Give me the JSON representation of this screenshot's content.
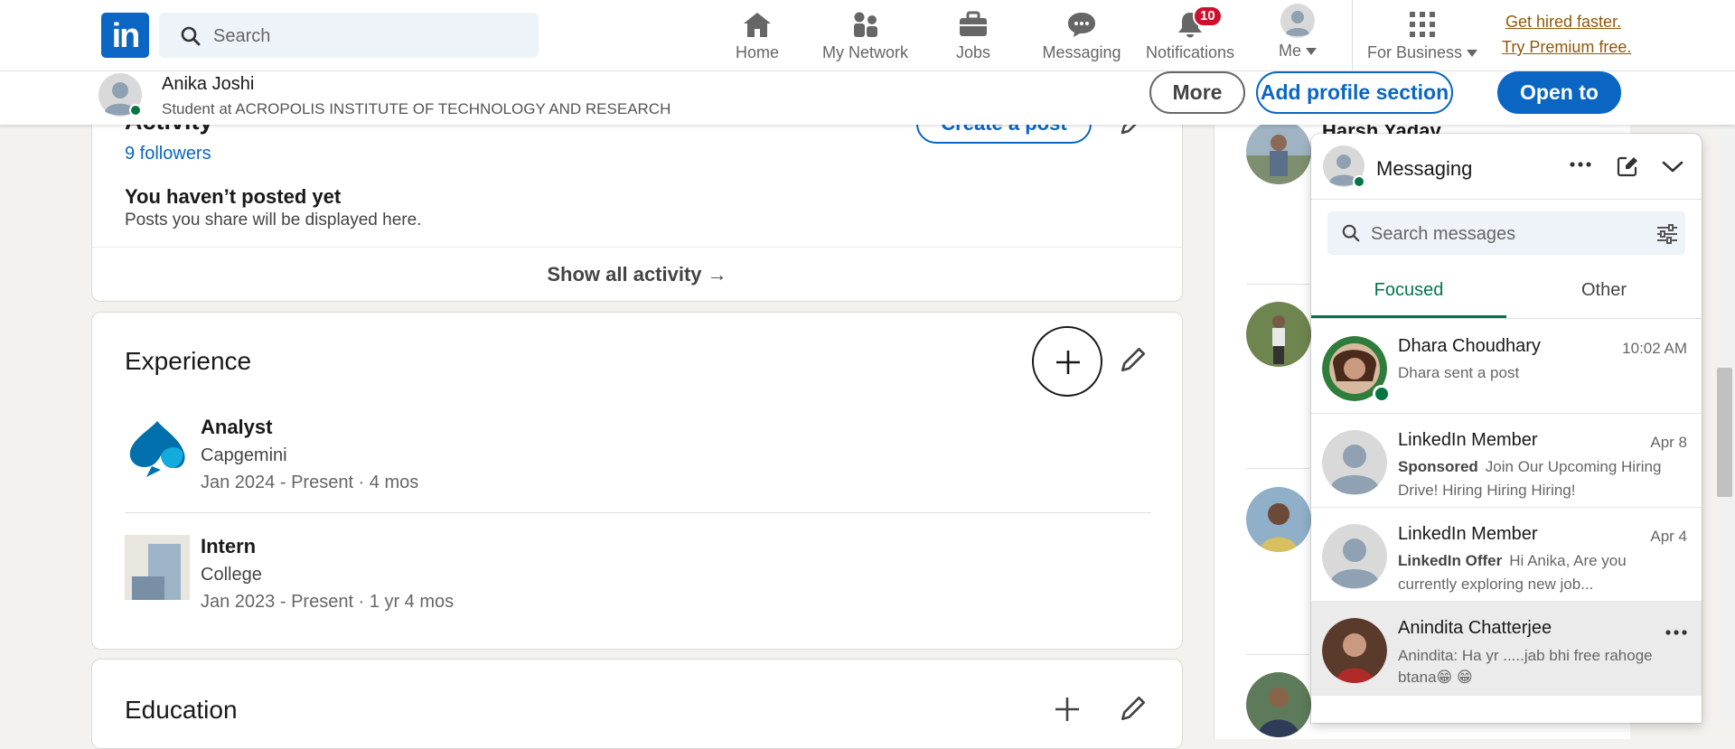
{
  "nav": {
    "logo_text": "in",
    "search_placeholder": "Search",
    "items": [
      {
        "label": "Home",
        "icon": "home-icon"
      },
      {
        "label": "My Network",
        "icon": "network-icon"
      },
      {
        "label": "Jobs",
        "icon": "briefcase-icon"
      },
      {
        "label": "Messaging",
        "icon": "messaging-icon"
      },
      {
        "label": "Notifications",
        "icon": "bell-icon",
        "badge": "10"
      },
      {
        "label": "Me",
        "icon": "avatar"
      }
    ],
    "business_label": "For Business",
    "premium_line1": "Get hired faster.",
    "premium_line2": "Try Premium free."
  },
  "profile_bar": {
    "name": "Anika Joshi",
    "headline": "Student at ACROPOLIS INSTITUTE OF TECHNOLOGY AND RESEARCH",
    "more_label": "More",
    "add_section_label": "Add profile section",
    "open_to_label": "Open to"
  },
  "activity": {
    "title": "Activity",
    "create_post_label": "Create a post",
    "followers": "9 followers",
    "empty_title": "You haven’t posted yet",
    "empty_subtitle": "Posts you share will be displayed here.",
    "show_all": "Show all activity →"
  },
  "experience": {
    "title": "Experience",
    "items": [
      {
        "role": "Analyst",
        "org": "Capgemini",
        "dates": "Jan 2024 - Present · 4 mos",
        "logo": "capgemini-logo"
      },
      {
        "role": "Intern",
        "org": "College",
        "dates": "Jan 2023 - Present · 1 yr 4 mos",
        "logo": "company-placeholder-logo"
      }
    ]
  },
  "education": {
    "title": "Education"
  },
  "sidebar": {
    "first_name_partial": "Harsh Yadav"
  },
  "messaging": {
    "title": "Messaging",
    "search_placeholder": "Search messages",
    "tabs": [
      "Focused",
      "Other"
    ],
    "conversations": [
      {
        "name": "Dhara Choudhary",
        "time": "10:02 AM",
        "sponsor": "",
        "preview": "Dhara sent a post"
      },
      {
        "name": "LinkedIn Member",
        "time": "Apr 8",
        "sponsor": "Sponsored",
        "preview": "Join Our Upcoming Hiring Drive! Hiring Hiring Hiring!"
      },
      {
        "name": "LinkedIn Member",
        "time": "Apr 4",
        "sponsor": "LinkedIn Offer",
        "preview": "Hi Anika, Are you currently exploring new job..."
      },
      {
        "name": "Anindita Chatterjee",
        "time": "",
        "sponsor": "",
        "preview": "Anindita: Ha yr .....jab bhi free rahoge btana😁 😁"
      }
    ]
  },
  "colors": {
    "brand_blue": "#0a66c2",
    "focused_green": "#01754f",
    "premium_gold": "#915907",
    "notification_red": "#cb112d"
  }
}
